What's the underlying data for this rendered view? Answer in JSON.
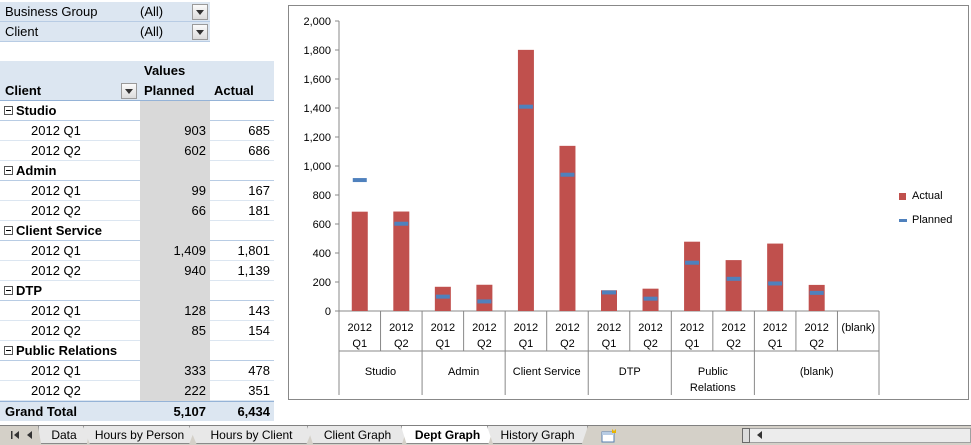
{
  "filters": [
    {
      "label": "Business Group",
      "value": "(All)"
    },
    {
      "label": "Client",
      "value": "(All)"
    }
  ],
  "pivot": {
    "values_header": "Values",
    "row_header": "Client",
    "col_planned": "Planned",
    "col_actual": "Actual",
    "groups": [
      {
        "name": "Studio",
        "rows": [
          {
            "label": "2012 Q1",
            "planned": "903",
            "actual": "685"
          },
          {
            "label": "2012 Q2",
            "planned": "602",
            "actual": "686"
          }
        ]
      },
      {
        "name": "Admin",
        "rows": [
          {
            "label": "2012 Q1",
            "planned": "99",
            "actual": "167"
          },
          {
            "label": "2012 Q2",
            "planned": "66",
            "actual": "181"
          }
        ]
      },
      {
        "name": "Client Service",
        "rows": [
          {
            "label": "2012 Q1",
            "planned": "1,409",
            "actual": "1,801"
          },
          {
            "label": "2012 Q2",
            "planned": "940",
            "actual": "1,139"
          }
        ]
      },
      {
        "name": "DTP",
        "rows": [
          {
            "label": "2012 Q1",
            "planned": "128",
            "actual": "143"
          },
          {
            "label": "2012 Q2",
            "planned": "85",
            "actual": "154"
          }
        ]
      },
      {
        "name": "Public Relations",
        "rows": [
          {
            "label": "2012 Q1",
            "planned": "333",
            "actual": "478"
          },
          {
            "label": "2012 Q2",
            "planned": "222",
            "actual": "351"
          }
        ]
      }
    ],
    "grand_total": {
      "label": "Grand Total",
      "planned": "5,107",
      "actual": "6,434"
    }
  },
  "chart_data": {
    "type": "bar",
    "ylim": [
      0,
      2000
    ],
    "yticks": [
      "0",
      "200",
      "400",
      "600",
      "800",
      "1,000",
      "1,200",
      "1,400",
      "1,600",
      "1,800",
      "2,000"
    ],
    "groups": [
      {
        "name": "Studio",
        "name_lines": [
          "Studio"
        ],
        "periods": [
          {
            "l1": "2012",
            "l2": "Q1",
            "actual": 685,
            "planned": 903
          },
          {
            "l1": "2012",
            "l2": "Q2",
            "actual": 686,
            "planned": 602
          }
        ]
      },
      {
        "name": "Admin",
        "name_lines": [
          "Admin"
        ],
        "periods": [
          {
            "l1": "2012",
            "l2": "Q1",
            "actual": 167,
            "planned": 99
          },
          {
            "l1": "2012",
            "l2": "Q2",
            "actual": 181,
            "planned": 66
          }
        ]
      },
      {
        "name": "Client Service",
        "name_lines": [
          "Client Service"
        ],
        "periods": [
          {
            "l1": "2012",
            "l2": "Q1",
            "actual": 1801,
            "planned": 1409
          },
          {
            "l1": "2012",
            "l2": "Q2",
            "actual": 1139,
            "planned": 940
          }
        ]
      },
      {
        "name": "DTP",
        "name_lines": [
          "DTP"
        ],
        "periods": [
          {
            "l1": "2012",
            "l2": "Q1",
            "actual": 143,
            "planned": 128
          },
          {
            "l1": "2012",
            "l2": "Q2",
            "actual": 154,
            "planned": 85
          }
        ]
      },
      {
        "name": "Public Relations",
        "name_lines": [
          "Public",
          "Relations"
        ],
        "periods": [
          {
            "l1": "2012",
            "l2": "Q1",
            "actual": 478,
            "planned": 333
          },
          {
            "l1": "2012",
            "l2": "Q2",
            "actual": 351,
            "planned": 222
          }
        ]
      },
      {
        "name": "(blank)",
        "name_lines": [
          "(blank)"
        ],
        "periods": [
          {
            "l1": "2012",
            "l2": "Q1",
            "actual": 465,
            "planned": 190
          },
          {
            "l1": "2012",
            "l2": "Q2",
            "actual": 180,
            "planned": 125
          },
          {
            "l1": "(blank)",
            "l2": "",
            "actual": null,
            "planned": null
          }
        ]
      }
    ],
    "series": [
      {
        "name": "Actual",
        "color": "#c0504d"
      },
      {
        "name": "Planned",
        "color": "#4f81bd"
      }
    ],
    "legend_position": "right"
  },
  "sheet_tabs": [
    {
      "label": "Data",
      "active": false
    },
    {
      "label": "Hours by Person",
      "active": false
    },
    {
      "label": "Hours by Client",
      "active": false
    },
    {
      "label": "Client Graph",
      "active": false
    },
    {
      "label": "Dept Graph",
      "active": true
    },
    {
      "label": "History Graph",
      "active": false
    }
  ],
  "icons": {
    "dropdown": "dropdown-arrow-icon",
    "collapse": "collapse-minus-icon",
    "new_sheet": "insert-worksheet-icon"
  }
}
